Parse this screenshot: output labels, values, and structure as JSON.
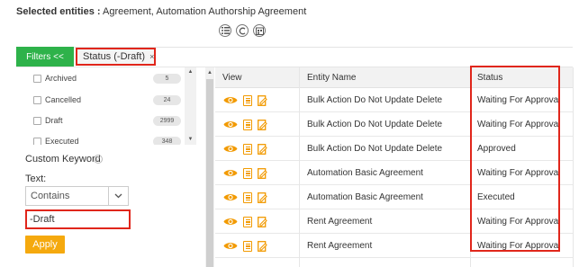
{
  "selected": {
    "label": "Selected entities :",
    "value": "Agreement, Automation Authorship Agreement"
  },
  "view_icons": [
    "list-view-icon",
    "grid-view-icon",
    "calendar-view-icon"
  ],
  "filters": {
    "toggle_label": "Filters <<",
    "chip_label": "Status (-Draft)",
    "chip_close": "×",
    "status_options": [
      {
        "label": "Archived",
        "count": "5"
      },
      {
        "label": "Cancelled",
        "count": "24"
      },
      {
        "label": "Draft",
        "count": "2999"
      },
      {
        "label": "Executed",
        "count": "348"
      }
    ],
    "custom_keyword_label": "Custom Keyword",
    "help_glyph": "?",
    "text_label": "Text:",
    "operator_value": "Contains",
    "keyword_value": "-Draft",
    "apply_label": "Apply"
  },
  "table": {
    "columns": [
      "View",
      "Entity Name",
      "Status"
    ],
    "rows": [
      {
        "entity": "Bulk Action Do Not Update Delete",
        "status": "Waiting For Approval"
      },
      {
        "entity": "Bulk Action Do Not Update Delete",
        "status": "Waiting For Approval"
      },
      {
        "entity": "Bulk Action Do Not Update Delete",
        "status": "Approved"
      },
      {
        "entity": "Automation Basic Agreement",
        "status": "Waiting For Approval"
      },
      {
        "entity": "Automation Basic Agreement",
        "status": "Executed"
      },
      {
        "entity": "Rent Agreement",
        "status": "Waiting For Approval"
      },
      {
        "entity": "Rent Agreement",
        "status": "Waiting For Approval"
      }
    ]
  },
  "colors": {
    "green": "#2eb24a",
    "highlight": "#e0261b",
    "apply": "#f5a90e",
    "icon_orange": "#f29a00"
  }
}
